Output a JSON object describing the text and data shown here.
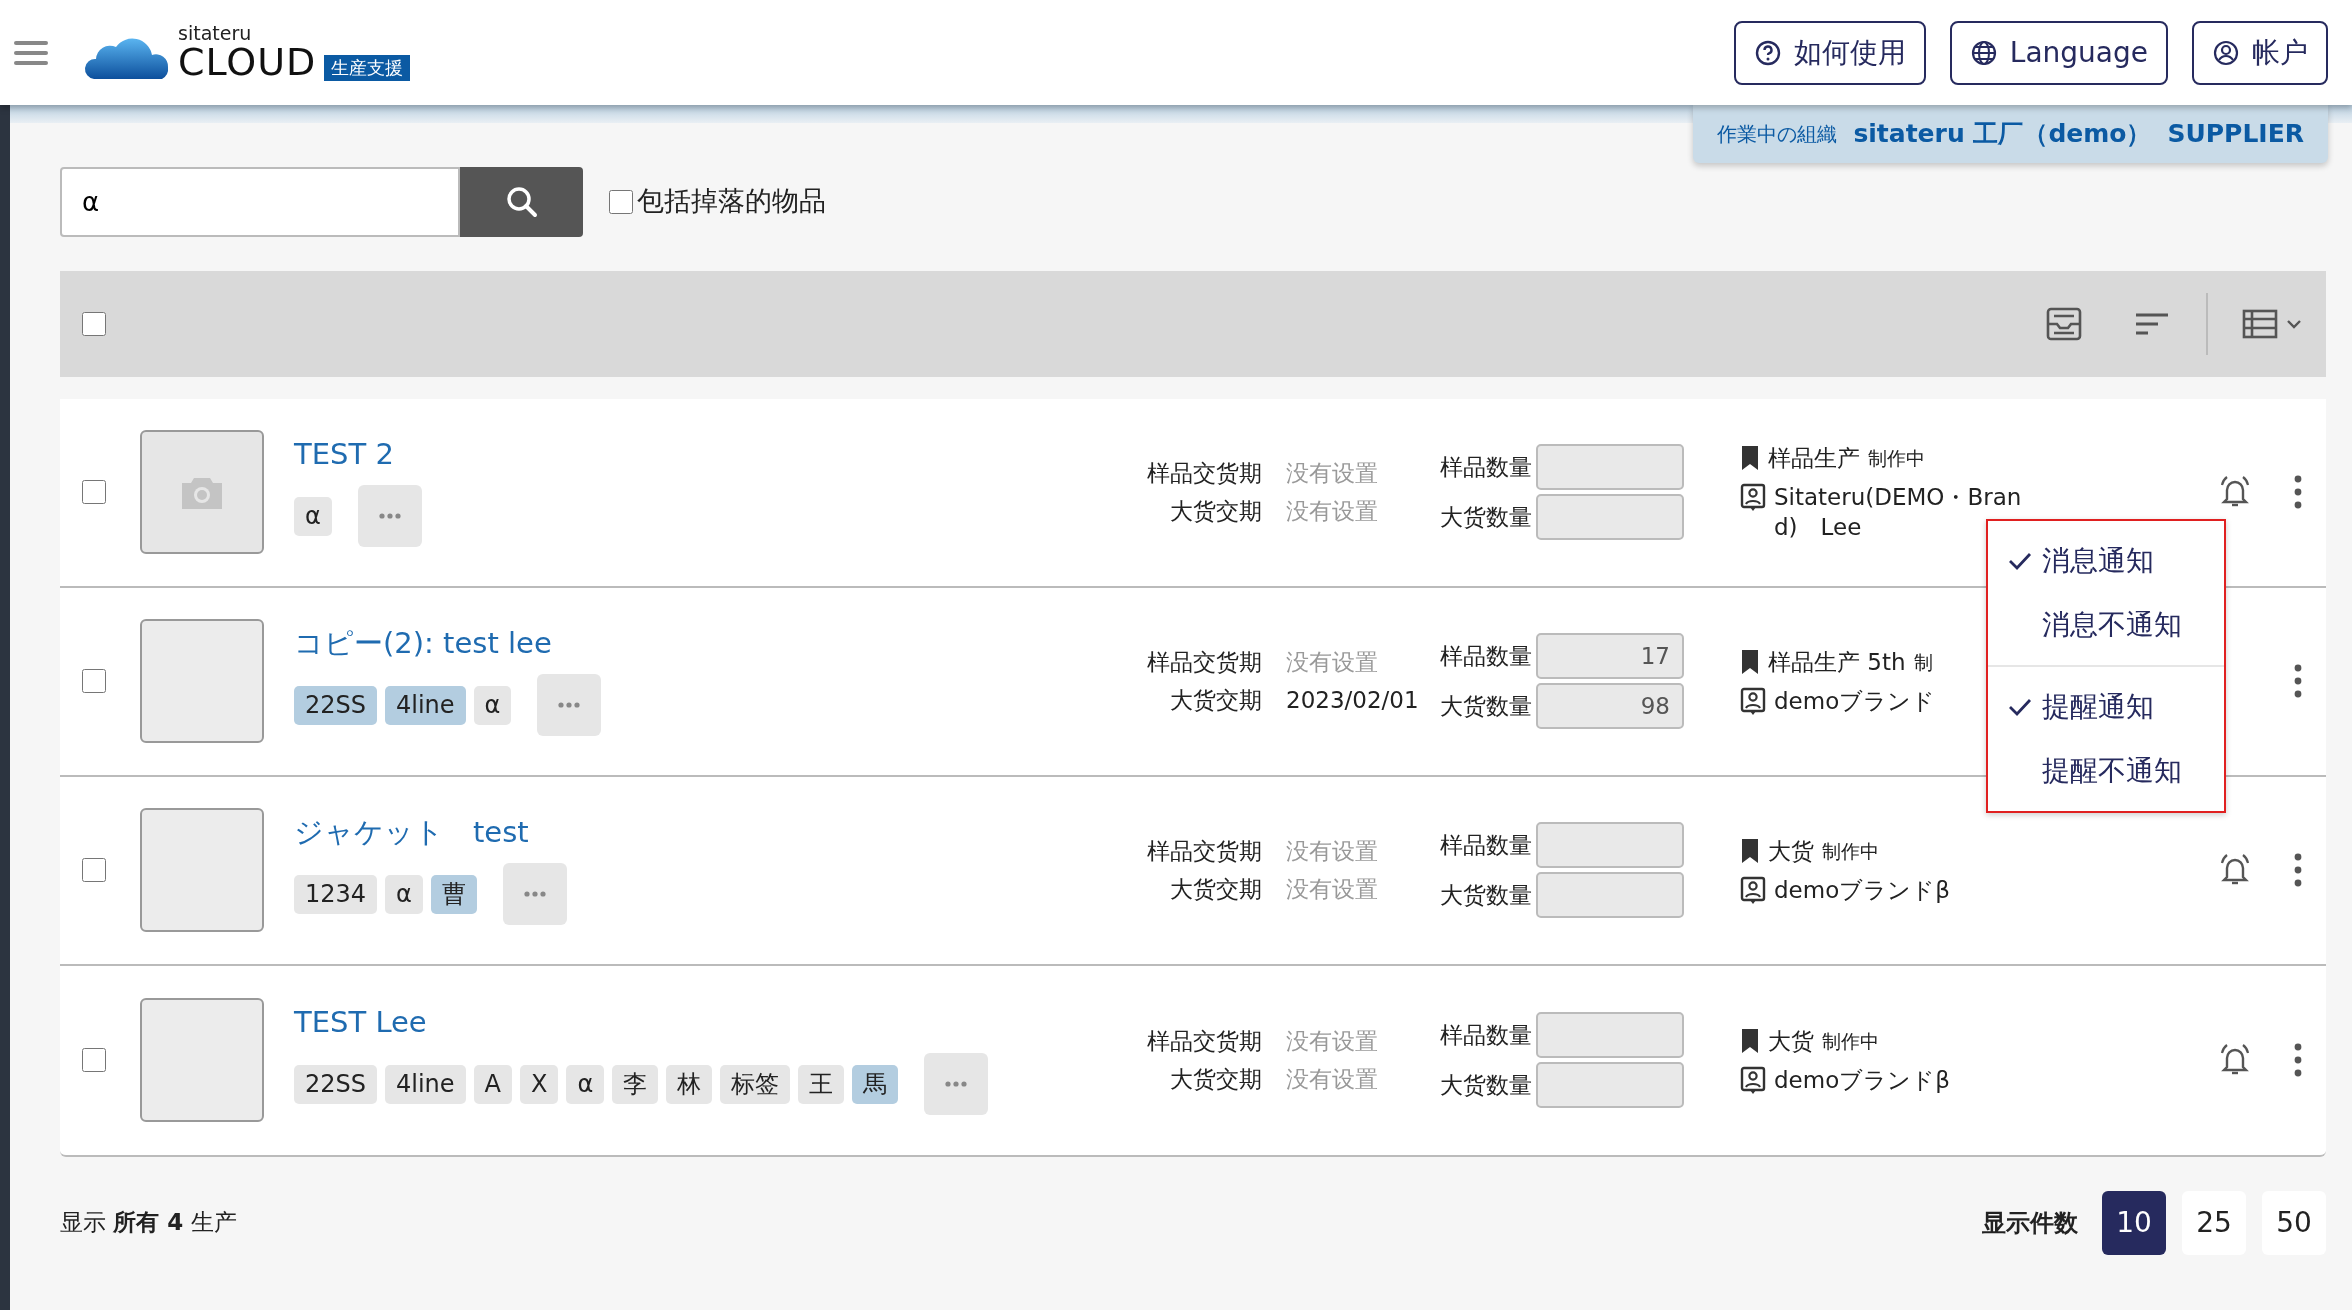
{
  "header": {
    "logo": {
      "small": "sitateru",
      "big": "CLOUD",
      "badge": "生産支援"
    },
    "buttons": [
      {
        "kind": "help",
        "label": "如何使用"
      },
      {
        "kind": "language",
        "label": "Language"
      },
      {
        "kind": "account",
        "label": "帐户"
      }
    ]
  },
  "organization": {
    "label": "作業中の組織",
    "name": "sitateru 工厂（demo）",
    "role": "SUPPLIER"
  },
  "search": {
    "value": "α",
    "include_dropped": {
      "label": "包括掉落的物品",
      "checked": false
    }
  },
  "toolbar": {
    "select_all": false
  },
  "rows": [
    {
      "checked": false,
      "thumbnail": {
        "kind": "none"
      },
      "title": "TEST 2",
      "tags": [
        {
          "label": "α",
          "color": "#e6e6e6"
        }
      ],
      "sample_date_label": "样品交货期",
      "sample_date": "没有设置",
      "sample_date_set": false,
      "bulk_date_label": "大货交期",
      "bulk_date": "没有设置",
      "bulk_date_set": false,
      "sample_qty_label": "样品数量",
      "sample_qty": "",
      "bulk_qty_label": "大货数量",
      "bulk_qty": "",
      "phase": "样品生产",
      "status": "制作中",
      "company": "Sitateru(DEMO・Brand)　Lee",
      "bell": true,
      "notify_menu": [
        {
          "kind": "item",
          "label": "消息通知",
          "checked": true
        },
        {
          "kind": "item",
          "label": "消息不通知",
          "checked": false
        },
        {
          "kind": "divider"
        },
        {
          "kind": "item",
          "label": "提醒通知",
          "checked": true
        },
        {
          "kind": "item",
          "label": "提醒不通知",
          "checked": false
        }
      ]
    },
    {
      "checked": false,
      "thumbnail": {
        "kind": "photo"
      },
      "title": "コピー(2): test lee",
      "tags": [
        {
          "label": "22SS",
          "color": "#b3cde0"
        },
        {
          "label": "4line",
          "color": "#b3cde0"
        },
        {
          "label": "α",
          "color": "#e6e6e6"
        }
      ],
      "sample_date_label": "样品交货期",
      "sample_date": "没有设置",
      "sample_date_set": false,
      "bulk_date_label": "大货交期",
      "bulk_date": "2023/02/01",
      "bulk_date_set": true,
      "sample_qty_label": "样品数量",
      "sample_qty": "17",
      "bulk_qty_label": "大货数量",
      "bulk_qty": "98",
      "phase": "样品生产 5th",
      "status": "制",
      "company": "demoブランド",
      "bell": false
    },
    {
      "checked": false,
      "thumbnail": {
        "kind": "photo"
      },
      "title": "ジャケット　test",
      "tags": [
        {
          "label": "1234",
          "color": "#e6e6e6"
        },
        {
          "label": "α",
          "color": "#e6e6e6"
        },
        {
          "label": "曹",
          "color": "#b3cde0"
        }
      ],
      "sample_date_label": "样品交货期",
      "sample_date": "没有设置",
      "sample_date_set": false,
      "bulk_date_label": "大货交期",
      "bulk_date": "没有设置",
      "bulk_date_set": false,
      "sample_qty_label": "样品数量",
      "sample_qty": "",
      "bulk_qty_label": "大货数量",
      "bulk_qty": "",
      "phase": "大货",
      "status": "制作中",
      "company": "demoブランドβ",
      "bell": true
    },
    {
      "checked": false,
      "thumbnail": {
        "kind": "photo"
      },
      "title": "TEST Lee",
      "tags": [
        {
          "label": "22SS",
          "color": "#e6e6e6"
        },
        {
          "label": "4line",
          "color": "#e6e6e6"
        },
        {
          "label": "A",
          "color": "#e6e6e6"
        },
        {
          "label": "X",
          "color": "#e6e6e6"
        },
        {
          "label": "α",
          "color": "#e6e6e6"
        },
        {
          "label": "李",
          "color": "#e6e6e6"
        },
        {
          "label": "林",
          "color": "#e6e6e6"
        },
        {
          "label": "标签",
          "color": "#e6e6e6"
        },
        {
          "label": "王",
          "color": "#e6e6e6"
        },
        {
          "label": "馬",
          "color": "#b3cde0"
        }
      ],
      "sample_date_label": "样品交货期",
      "sample_date": "没有设置",
      "sample_date_set": false,
      "bulk_date_label": "大货交期",
      "bulk_date": "没有设置",
      "bulk_date_set": false,
      "sample_qty_label": "样品数量",
      "sample_qty": "",
      "bulk_qty_label": "大货数量",
      "bulk_qty": "",
      "phase": "大货",
      "status": "制作中",
      "company": "demoブランドβ",
      "bell": true
    }
  ],
  "footer": {
    "summary": "显示 **所有 4** 生产",
    "page_size_label": "显示件数",
    "page_sizes": [
      {
        "label": "10",
        "selected": true
      },
      {
        "label": "25",
        "selected": false
      },
      {
        "label": "50",
        "selected": false
      }
    ]
  }
}
